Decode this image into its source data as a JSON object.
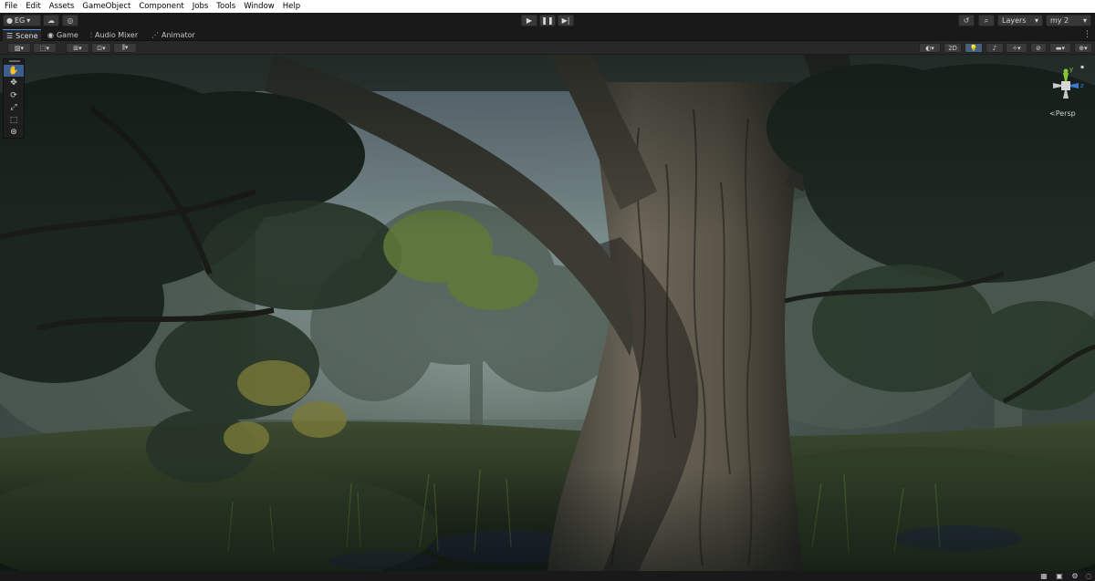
{
  "menu": [
    "File",
    "Edit",
    "Assets",
    "GameObject",
    "Component",
    "Jobs",
    "Tools",
    "Window",
    "Help"
  ],
  "toolbar": {
    "account_label": "EG",
    "layers_label": "Layers",
    "layout_label": "my 2"
  },
  "tabs": [
    {
      "label": "Scene",
      "icon": "scene-icon"
    },
    {
      "label": "Game",
      "icon": "game-icon"
    },
    {
      "label": "Audio Mixer",
      "icon": "audio-mixer-icon"
    },
    {
      "label": "Animator",
      "icon": "animator-icon"
    }
  ],
  "scene_toolbar": {
    "mode_2d_label": "2D"
  },
  "tools": [
    "hand-tool",
    "move-tool",
    "rotate-tool",
    "scale-tool",
    "rect-tool",
    "transform-tool"
  ],
  "gizmo": {
    "projection_label": "Persp",
    "y_axis_label": "y",
    "z_axis_label": "z"
  },
  "colors": {
    "accent": "#3b5f8f",
    "x_axis": "#d9393a",
    "y_axis": "#8ac43a",
    "z_axis": "#3a7ad9"
  }
}
